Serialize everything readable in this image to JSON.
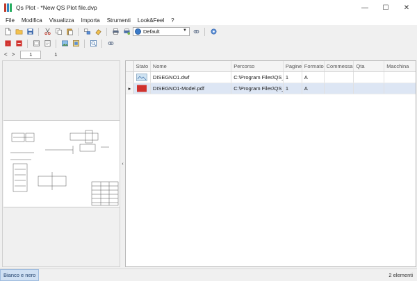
{
  "window": {
    "title": "Qs Plot - *New QS Plot file.dvp",
    "minimize_glyph": "—",
    "maximize_glyph": "☐",
    "close_glyph": "✕"
  },
  "menu": [
    "File",
    "Modifica",
    "Visualizza",
    "Importa",
    "Strumenti",
    "Look&Feel",
    "?"
  ],
  "toolbar": {
    "profile_value": "Default",
    "row1_icons": [
      "new-file-icon",
      "open-folder-icon",
      "save-icon",
      "cut-icon",
      "copy-icon",
      "paste-icon",
      "order-icon",
      "eraser-icon",
      "printer-icon",
      "print-settings-icon",
      "globe-icon",
      "link-icon",
      "gear-icon"
    ],
    "row2_icons": [
      "add-pdf-icon",
      "remove-icon",
      "frame-icon",
      "page-icon",
      "image-icon",
      "zoom-fit-icon",
      "zoom-page-icon",
      "link-icon"
    ]
  },
  "pager": {
    "prev": "<",
    "next": ">",
    "current": "1",
    "total": "1"
  },
  "grid": {
    "columns": [
      "Stato",
      "Nome",
      "Percorso",
      "Pagine",
      "Formato",
      "Commessa",
      "Qta",
      "Macchina"
    ],
    "rows": [
      {
        "type": "dwf",
        "nome": "DISEGNO1.dwf",
        "percorso": "C:\\Program Files\\QS_I...",
        "pagine": "1",
        "formato": "A",
        "commessa": "",
        "qta": "",
        "macchina": "",
        "selected": false
      },
      {
        "type": "pdf",
        "nome": "DISEGNO1-Model.pdf",
        "percorso": "C:\\Program Files\\QS_I...",
        "pagine": "1",
        "formato": "A",
        "commessa": "",
        "qta": "",
        "macchina": "",
        "selected": true
      }
    ],
    "current_row_marker": "▸",
    "pdf_badge": "PDF"
  },
  "splitter_glyph": "‹",
  "status": {
    "mode": "Bianco e nero",
    "count": "2 elementi"
  },
  "colors": {
    "accent": "#dde6f4",
    "status_highlight": "#cfe0f3"
  }
}
